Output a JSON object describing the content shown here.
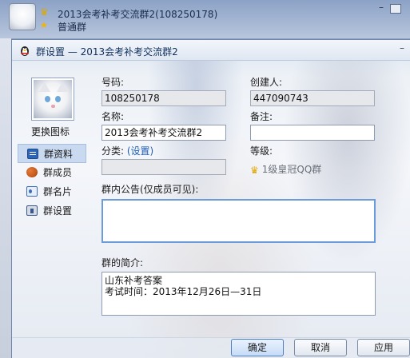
{
  "chat_window": {
    "title": "2013会考补考交流群2(108250178)",
    "subtitle": "普通群",
    "minimize": "–",
    "maximize": "▫"
  },
  "dialog": {
    "title": "群设置 — 2013会考补考交流群2",
    "minimize": "–"
  },
  "sidebar": {
    "change_icon": "更换图标",
    "items": [
      {
        "label": "群资料",
        "icon": "info-icon",
        "active": true
      },
      {
        "label": "群成员",
        "icon": "members-icon",
        "active": false
      },
      {
        "label": "群名片",
        "icon": "card-icon",
        "active": false
      },
      {
        "label": "群设置",
        "icon": "settings-icon",
        "active": false
      }
    ]
  },
  "form": {
    "number_label": "号码:",
    "number_value": "108250178",
    "creator_label": "创建人:",
    "creator_value": "447090743",
    "name_label": "名称:",
    "name_value": "2013会考补考交流群2",
    "remark_label": "备注:",
    "remark_value": "",
    "category_label": "分类:",
    "category_link": "(设置)",
    "category_value": "",
    "level_label": "等级:",
    "level_value": "1级皇冠QQ群",
    "notice_label": "群内公告(仅成员可见):",
    "notice_value": "",
    "intro_label": "群的简介:",
    "intro_value": "山东补考答案\n考试时间：2013年12月26日—31日"
  },
  "buttons": {
    "ok": "确定",
    "cancel": "取消",
    "apply": "应用"
  },
  "colors": {
    "accent": "#1f5fb8",
    "title_text": "#10305e",
    "active_nav_bg": "#c9d9f0"
  }
}
